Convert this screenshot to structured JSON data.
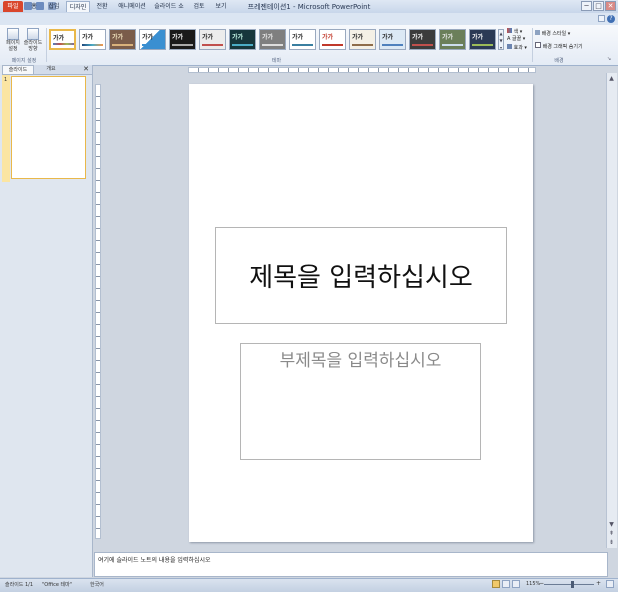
{
  "window": {
    "title": "프레젠테이션1 - Microsoft PowerPoint",
    "controls": [
      "─",
      "□",
      "✕"
    ]
  },
  "tabs": [
    {
      "label": "파일",
      "kind": "file"
    },
    {
      "label": "홈"
    },
    {
      "label": "삽입"
    },
    {
      "label": "디자인",
      "active": true
    },
    {
      "label": "전환"
    },
    {
      "label": "애니메이션"
    },
    {
      "label": "슬라이드 쇼"
    },
    {
      "label": "검토"
    },
    {
      "label": "보기"
    }
  ],
  "ribbon": {
    "page_setup": {
      "btn1": "페이지\n설정",
      "btn2": "슬라이드\n방향",
      "group": "페이지 설정"
    },
    "themes": {
      "group": "테마",
      "sample_text": "가가"
    },
    "variants": {
      "colors": "색",
      "fonts": "글꼴",
      "effects": "효과"
    },
    "background": {
      "style": "배경 스타일",
      "hide": "배경 그래픽 숨기기",
      "group": "배경"
    }
  },
  "left_pane": {
    "tab_slides": "슬라이드",
    "tab_outline": "개요",
    "slide_number": "1"
  },
  "slide": {
    "title_placeholder": "제목을 입력하십시오",
    "subtitle_placeholder": "부제목을 입력하십시오"
  },
  "notes": {
    "placeholder": "여기에 슬라이드 노트의 내용을 입력하십시오"
  },
  "status": {
    "slide_info": "슬라이드 1/1",
    "theme": "\"Office 테마\"",
    "language": "한국어",
    "zoom": "115%"
  },
  "colors": {
    "file_tab": "#d9462c",
    "accent": "#e9b84a"
  }
}
